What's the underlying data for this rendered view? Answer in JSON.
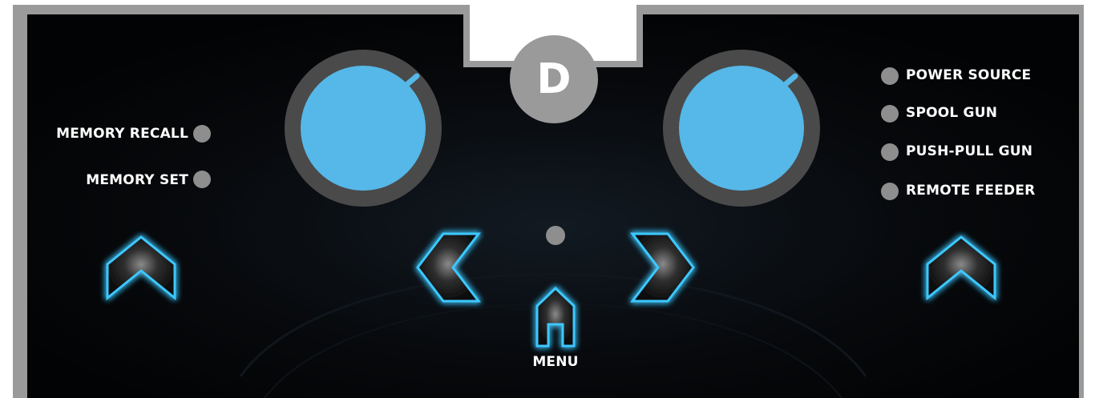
{
  "badge": {
    "letter": "D"
  },
  "memory": {
    "recall_label": "MEMORY RECALL",
    "set_label": "MEMORY SET"
  },
  "sources": [
    {
      "label": "POWER SOURCE"
    },
    {
      "label": "SPOOL GUN"
    },
    {
      "label": "PUSH-PULL GUN"
    },
    {
      "label": "REMOTE FEEDER"
    }
  ],
  "menu": {
    "label": "MENU"
  },
  "colors": {
    "frame": "#9a9a9a",
    "panel": "#050608",
    "knob_face": "#55b8e8",
    "knob_ring": "#4a4a4a",
    "glow": "#3cc8ff",
    "led": "#8e8e8e",
    "text": "#ffffff"
  },
  "icons": {
    "left_up": "chevron-up-icon",
    "left": "chevron-left-icon",
    "right": "chevron-right-icon",
    "home": "home-icon",
    "right_up": "chevron-up-icon"
  }
}
